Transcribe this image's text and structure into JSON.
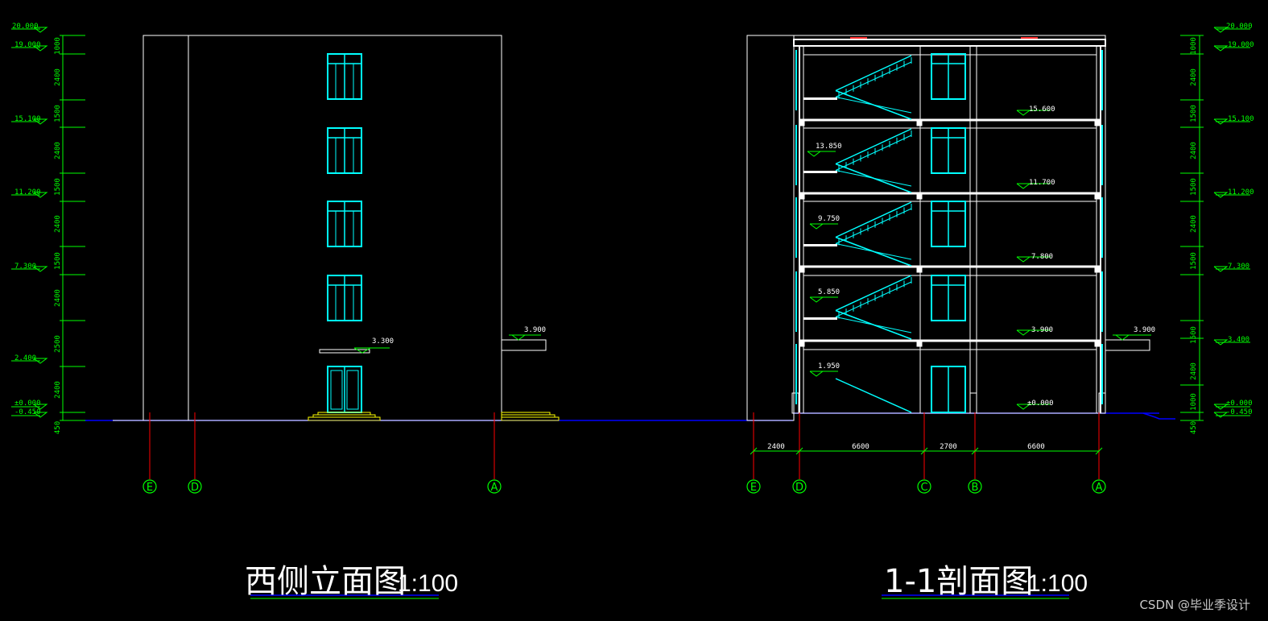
{
  "palette": {
    "background": "#000000",
    "outline": "#ffffff",
    "window": "#00ffff",
    "dimension": "#00ff00",
    "axis_line": "#ff0000",
    "ground": "#0000ff",
    "steps": "#ffff00",
    "title_underline": "#0000ff",
    "watermark": "#c8c8c8"
  },
  "left_elevation_marks": {
    "top": "20.000",
    "levels": [
      "19.000",
      "15.100",
      "11.200",
      "7.300",
      "2.400",
      "±0.000",
      "-0.450"
    ]
  },
  "left_segments": [
    "1000",
    "2400",
    "1500",
    "2400",
    "1500",
    "2400",
    "1500",
    "2400",
    "2500",
    "2400",
    "450"
  ],
  "right_elevation_marks": {
    "top": "20.000",
    "levels": [
      "19.000",
      "15.100",
      "11.200",
      "7.300",
      "3.400",
      "±0.000",
      "-0.450"
    ]
  },
  "right_segments": [
    "1000",
    "2400",
    "1500",
    "2400",
    "1500",
    "2400",
    "1500",
    "1500",
    "2400",
    "1000",
    "450"
  ],
  "elevation_view": {
    "title": "西侧立面图",
    "scale": "1:100",
    "canopy_level": "3.300",
    "annex_level": "3.900",
    "axes": [
      "E",
      "D",
      "A"
    ]
  },
  "section_view": {
    "title": "1-1剖面图",
    "scale": "1:100",
    "floor_levels": [
      "15.600",
      "11.700",
      "7.800",
      "3.900",
      "±0.000"
    ],
    "landing_levels": [
      "13.850",
      "9.750",
      "5.850",
      "1.950"
    ],
    "annex_level": "3.900",
    "spans": [
      "2400",
      "6600",
      "2700",
      "6600"
    ],
    "axes": [
      "E",
      "D",
      "C",
      "B",
      "A"
    ]
  },
  "watermark": "CSDN @毕业季设计"
}
